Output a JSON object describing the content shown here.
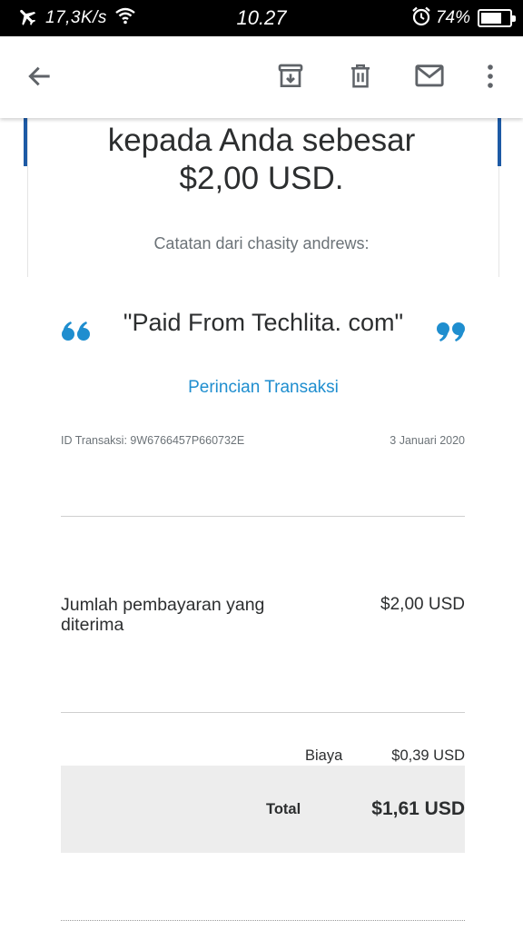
{
  "status_bar": {
    "speed": "17,3K/s",
    "time": "10.27",
    "battery_percent": "74%",
    "battery_level": 0.74,
    "icons": [
      "airplane-icon",
      "wifi-icon",
      "alarm-icon",
      "battery-icon"
    ]
  },
  "toolbar": {
    "icons": [
      "back-arrow-icon",
      "archive-icon",
      "trash-icon",
      "mail-icon",
      "more-vert-icon"
    ]
  },
  "email": {
    "headline_line1": "kepada Anda sebesar",
    "headline_line2": "$2,00 USD.",
    "note_label": "Catatan dari chasity andrews:",
    "note_text": "\"Paid From Techlita. com\"",
    "details_link": "Perincian Transaksi",
    "transaction_id": "ID Transaksi: 9W6766457P660732E",
    "transaction_date": "3 Januari 2020",
    "received_label": "Jumlah pembayaran yang diterima",
    "received_value": "$2,00 USD",
    "fee_label": "Biaya",
    "fee_value": "$0,39 USD",
    "total_label": "Total",
    "total_value": "$1,61 USD"
  },
  "colors": {
    "accent_blue": "#1d5aa5",
    "link_blue": "#1f8ecf",
    "quote_blue": "#1f8ecf",
    "total_bg": "#ededed"
  }
}
